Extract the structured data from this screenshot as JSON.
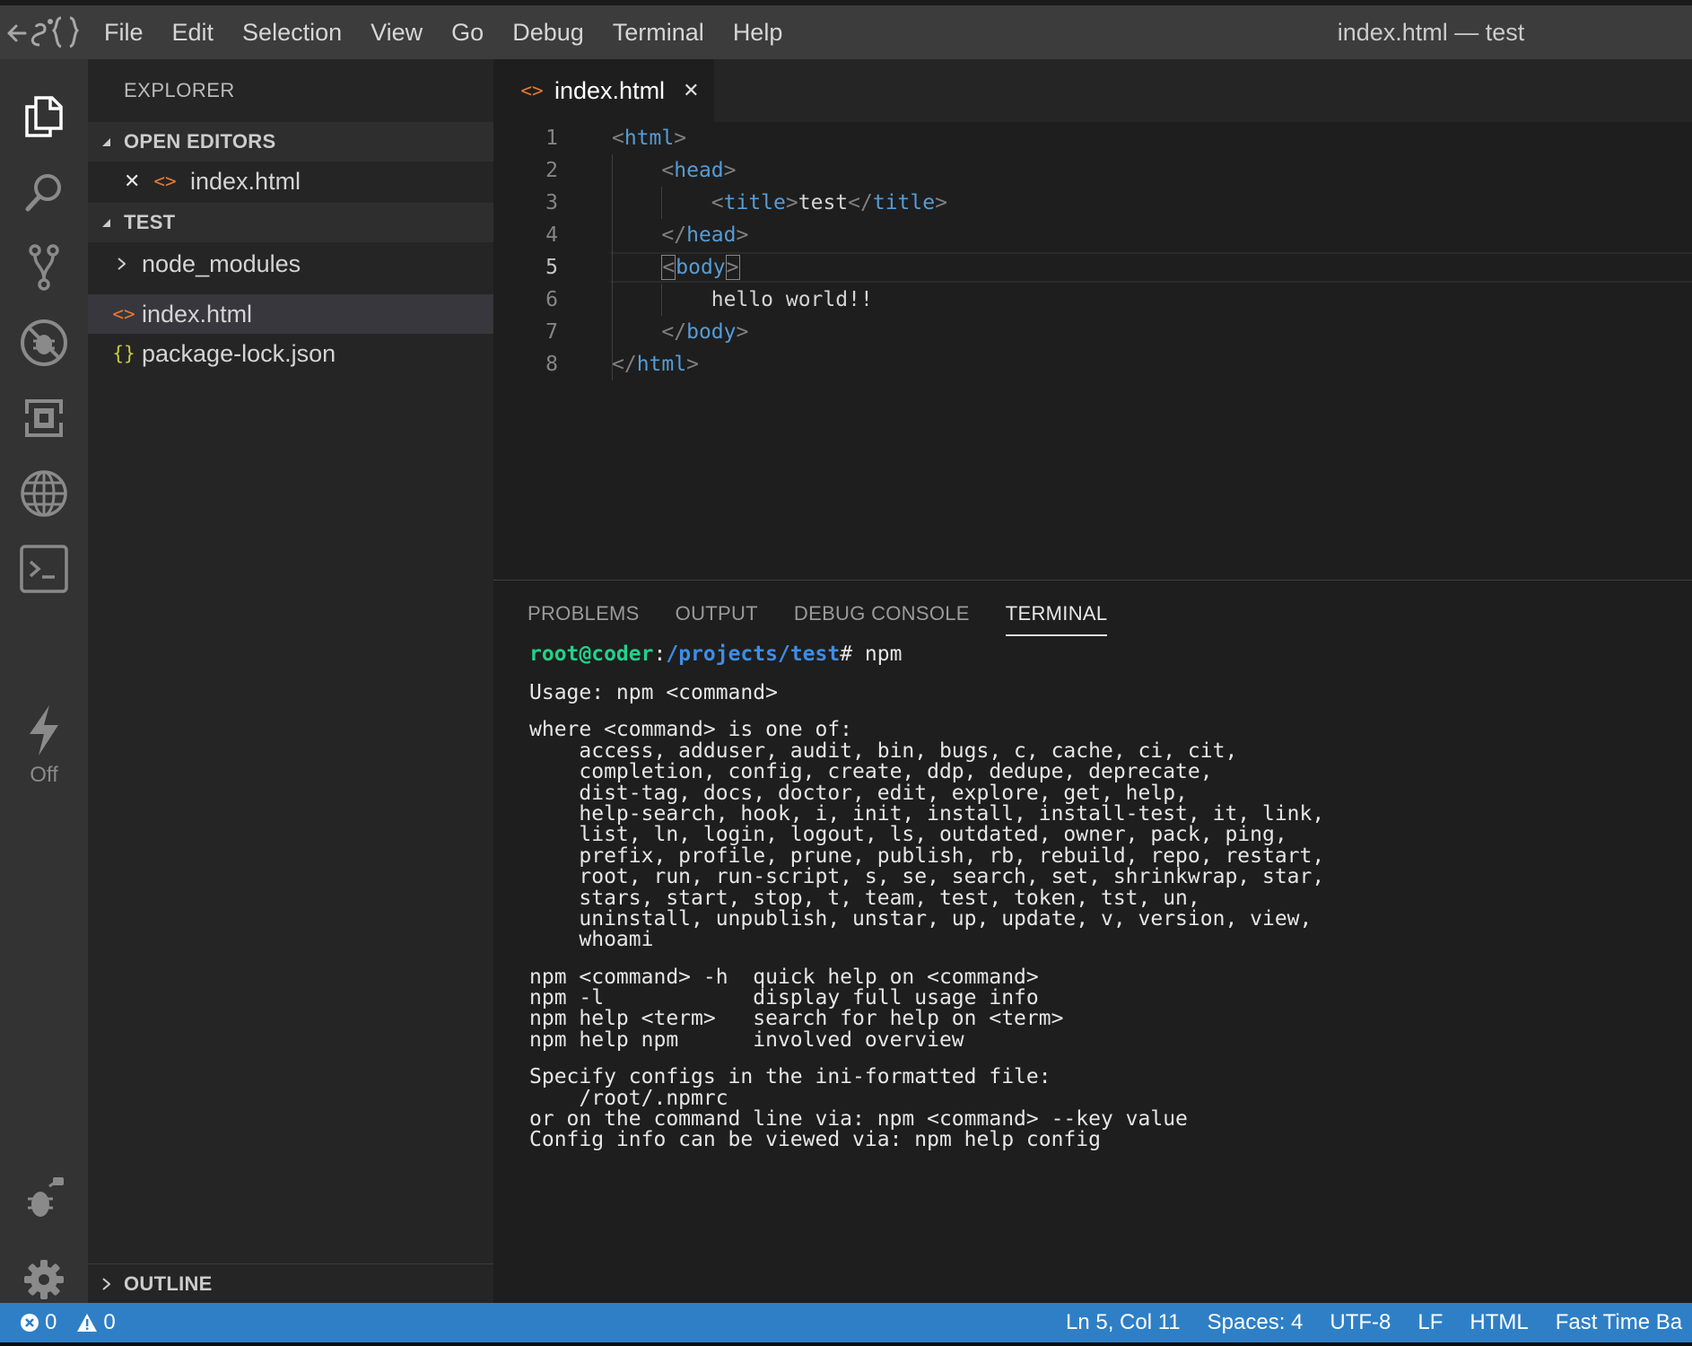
{
  "window_title": "index.html — test",
  "menu": [
    "File",
    "Edit",
    "Selection",
    "View",
    "Go",
    "Debug",
    "Terminal",
    "Help"
  ],
  "activity": {
    "off_label": "Off"
  },
  "sidebar": {
    "title": "EXPLORER",
    "open_editors_label": "OPEN EDITORS",
    "open_editors": [
      {
        "name": "index.html"
      }
    ],
    "folder_label": "TEST",
    "files": [
      {
        "name": "node_modules",
        "type": "folder"
      },
      {
        "name": "index.html",
        "type": "html"
      },
      {
        "name": "package-lock.json",
        "type": "json"
      }
    ],
    "outline_label": "OUTLINE"
  },
  "tab": {
    "label": "index.html",
    "close": "✕"
  },
  "editor": {
    "line_numbers": [
      "1",
      "2",
      "3",
      "4",
      "5",
      "6",
      "7",
      "8"
    ],
    "active_line": "5",
    "lines": [
      [
        {
          "t": "<",
          "c": "pun"
        },
        {
          "t": "html",
          "c": "tag"
        },
        {
          "t": ">",
          "c": "pun"
        }
      ],
      [
        {
          "t": "    ",
          "c": "txt"
        },
        {
          "t": "<",
          "c": "pun"
        },
        {
          "t": "head",
          "c": "tag"
        },
        {
          "t": ">",
          "c": "pun"
        }
      ],
      [
        {
          "t": "        ",
          "c": "txt"
        },
        {
          "t": "<",
          "c": "pun"
        },
        {
          "t": "title",
          "c": "tag"
        },
        {
          "t": ">",
          "c": "pun"
        },
        {
          "t": "test",
          "c": "txt"
        },
        {
          "t": "</",
          "c": "pun"
        },
        {
          "t": "title",
          "c": "tag"
        },
        {
          "t": ">",
          "c": "pun"
        }
      ],
      [
        {
          "t": "    ",
          "c": "txt"
        },
        {
          "t": "</",
          "c": "pun"
        },
        {
          "t": "head",
          "c": "tag"
        },
        {
          "t": ">",
          "c": "pun"
        }
      ],
      [
        {
          "t": "    ",
          "c": "txt"
        },
        {
          "t": "<",
          "c": "pun bracket"
        },
        {
          "t": "body",
          "c": "tag"
        },
        {
          "t": ">",
          "c": "pun bracket"
        }
      ],
      [
        {
          "t": "        ",
          "c": "txt"
        },
        {
          "t": "hello world!!",
          "c": "txt"
        }
      ],
      [
        {
          "t": "    ",
          "c": "txt"
        },
        {
          "t": "</",
          "c": "pun"
        },
        {
          "t": "body",
          "c": "tag"
        },
        {
          "t": ">",
          "c": "pun"
        }
      ],
      [
        {
          "t": "</",
          "c": "pun"
        },
        {
          "t": "html",
          "c": "tag"
        },
        {
          "t": ">",
          "c": "pun"
        }
      ]
    ]
  },
  "panel": {
    "tabs": [
      {
        "label": "PROBLEMS",
        "active": false
      },
      {
        "label": "OUTPUT",
        "active": false
      },
      {
        "label": "DEBUG CONSOLE",
        "active": false
      },
      {
        "label": "TERMINAL",
        "active": true
      }
    ]
  },
  "terminal": {
    "prompt_user": "root@coder",
    "prompt_sep": ":",
    "prompt_path": "/projects/test",
    "prompt_end": "# ",
    "command": "npm",
    "output": [
      "",
      "Usage: npm <command>",
      "",
      "where <command> is one of:",
      "    access, adduser, audit, bin, bugs, c, cache, ci, cit,",
      "    completion, config, create, ddp, dedupe, deprecate,",
      "    dist-tag, docs, doctor, edit, explore, get, help,",
      "    help-search, hook, i, init, install, install-test, it, link,",
      "    list, ln, login, logout, ls, outdated, owner, pack, ping,",
      "    prefix, profile, prune, publish, rb, rebuild, repo, restart,",
      "    root, run, run-script, s, se, search, set, shrinkwrap, star,",
      "    stars, start, stop, t, team, test, token, tst, un,",
      "    uninstall, unpublish, unstar, up, update, v, version, view,",
      "    whoami",
      "",
      "npm <command> -h  quick help on <command>",
      "npm -l            display full usage info",
      "npm help <term>   search for help on <term>",
      "npm help npm      involved overview",
      "",
      "Specify configs in the ini-formatted file:",
      "    /root/.npmrc",
      "or on the command line via: npm <command> --key value",
      "Config info can be viewed via: npm help config"
    ]
  },
  "status": {
    "errors": "0",
    "warnings": "0",
    "position": "Ln 5, Col 11",
    "spaces": "Spaces: 4",
    "encoding": "UTF-8",
    "eol": "LF",
    "language": "HTML",
    "extension": "Fast Time Ba"
  },
  "colors": {
    "statusbar": "#2f7fc6",
    "tag": "#569cd6",
    "prompt_user": "#23d18b",
    "prompt_path": "#3b8eea",
    "html_icon": "#e37933",
    "json_icon": "#cbcb41"
  }
}
